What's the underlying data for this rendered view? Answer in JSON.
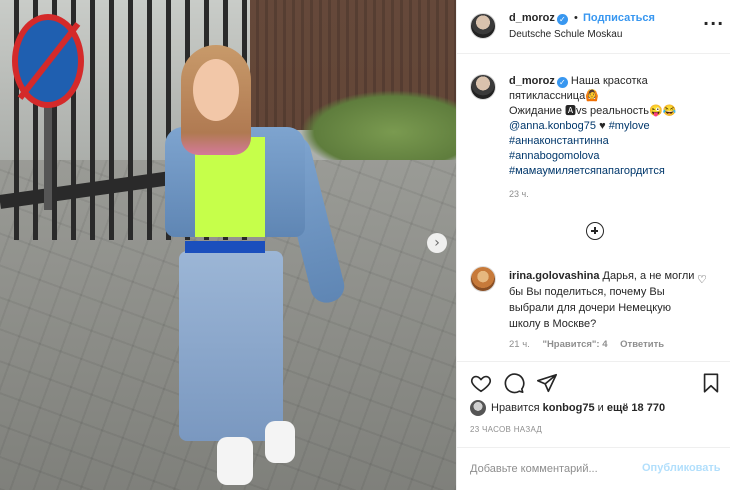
{
  "post": {
    "next_icon": "chevron-right-icon",
    "next_glyph": "›"
  },
  "header": {
    "username": "d_moroz",
    "dot": "•",
    "follow_label": "Подписаться",
    "location": "Deutsche Schule Moskau",
    "more_glyph": "···"
  },
  "caption": {
    "username": "d_moroz",
    "text_line1": "Наша красотка пятиклассница🙆",
    "text_line2": "Ожидание 🅰vs реальность😜😂",
    "mention": "@anna.konbog75",
    "heart": "♥",
    "tag_mylove": "#mylove",
    "hashtags": [
      "#аннаконстантинна",
      "#annabogomolova",
      "#мамаумиляетсяпапагордится"
    ],
    "time": "23 ч."
  },
  "comment": {
    "username": "irina.golovashina",
    "text": "Дарья, а не могли бы Вы поделиться, почему Вы выбрали для дочери Немецкую школу в Москве?",
    "time": "21 ч.",
    "likes_label": "\"Нравится\": 4",
    "reply_label": "Ответить",
    "heart_glyph": "♡"
  },
  "likes": {
    "prefix": "Нравится",
    "user": "konbog75",
    "middle": "и",
    "count": "ещё 18 770"
  },
  "posted": "23 ЧАСОВ НАЗАД",
  "add_comment": {
    "placeholder": "Добавьте комментарий...",
    "publish_label": "Опубликовать"
  },
  "colors": {
    "accent": "#3897f0",
    "link": "#00376b",
    "muted": "#8e8e8e",
    "publish_disabled": "#b2dffc"
  }
}
